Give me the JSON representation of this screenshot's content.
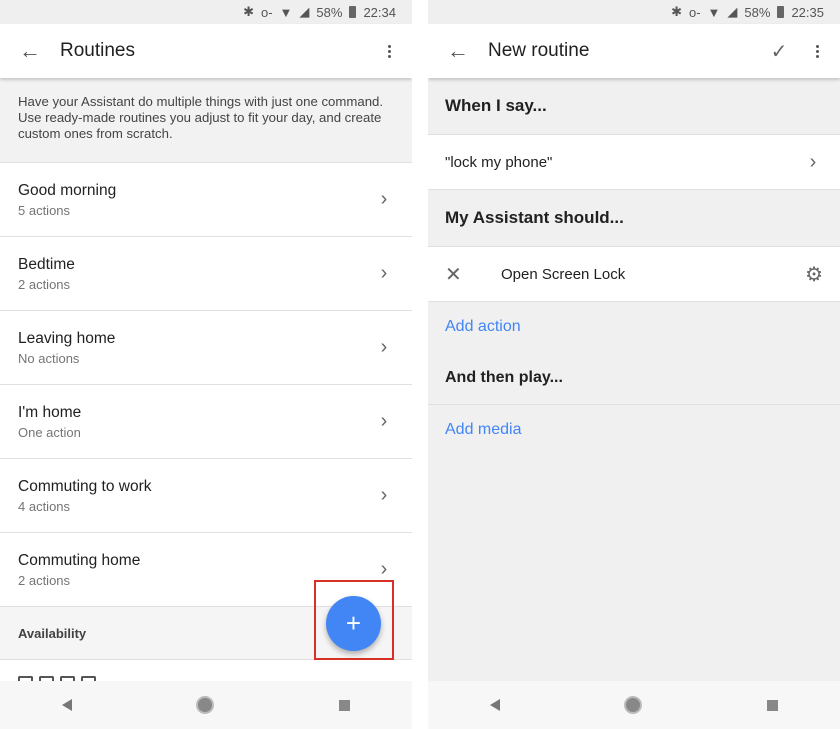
{
  "left": {
    "status": {
      "battery": "58%",
      "time": "22:34"
    },
    "title": "Routines",
    "intro": "Have your Assistant do multiple things with just one command. Use ready-made routines you adjust to fit your day, and create custom ones from scratch.",
    "routines": [
      {
        "name": "Good morning",
        "sub": "5 actions"
      },
      {
        "name": "Bedtime",
        "sub": "2 actions"
      },
      {
        "name": "Leaving home",
        "sub": "No actions"
      },
      {
        "name": "I'm home",
        "sub": "One action"
      },
      {
        "name": "Commuting to work",
        "sub": "4 actions"
      },
      {
        "name": "Commuting home",
        "sub": "2 actions"
      }
    ],
    "section_availability": "Availability",
    "fab_label": "+"
  },
  "right": {
    "status": {
      "battery": "58%",
      "time": "22:35"
    },
    "title": "New routine",
    "when_i_say": "When I say...",
    "phrase": "\"lock my phone\"",
    "assistant_should": "My Assistant should...",
    "action": "Open Screen Lock",
    "add_action": "Add action",
    "and_then_play": "And then play...",
    "add_media": "Add media"
  },
  "colors": {
    "accent": "#4285f4",
    "highlight": "#d93025"
  }
}
